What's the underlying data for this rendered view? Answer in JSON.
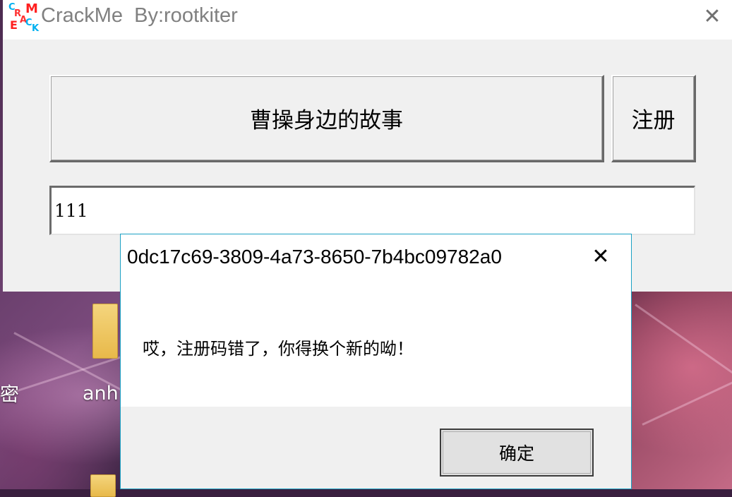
{
  "main_window": {
    "title": "CrackMe  By:rootkiter",
    "icon_letters": [
      "C",
      "R",
      "A",
      "M",
      "E",
      "C",
      "K"
    ],
    "close_glyph": "✕",
    "story_button_label": "曹操身边的故事",
    "register_button_label": "注册",
    "serial_input_value": "111"
  },
  "message_box": {
    "title": "0dc17c69-3809-4a73-8650-7b4bc09782a0",
    "close_glyph": "✕",
    "message": "哎，注册码错了，你得换个新的呦！",
    "ok_button_label": "确定"
  },
  "desktop": {
    "icon_labels": [
      "密",
      "anh"
    ]
  },
  "colors": {
    "msgbox_border": "#1ba1c4",
    "window_bg": "#f0f0f0"
  }
}
